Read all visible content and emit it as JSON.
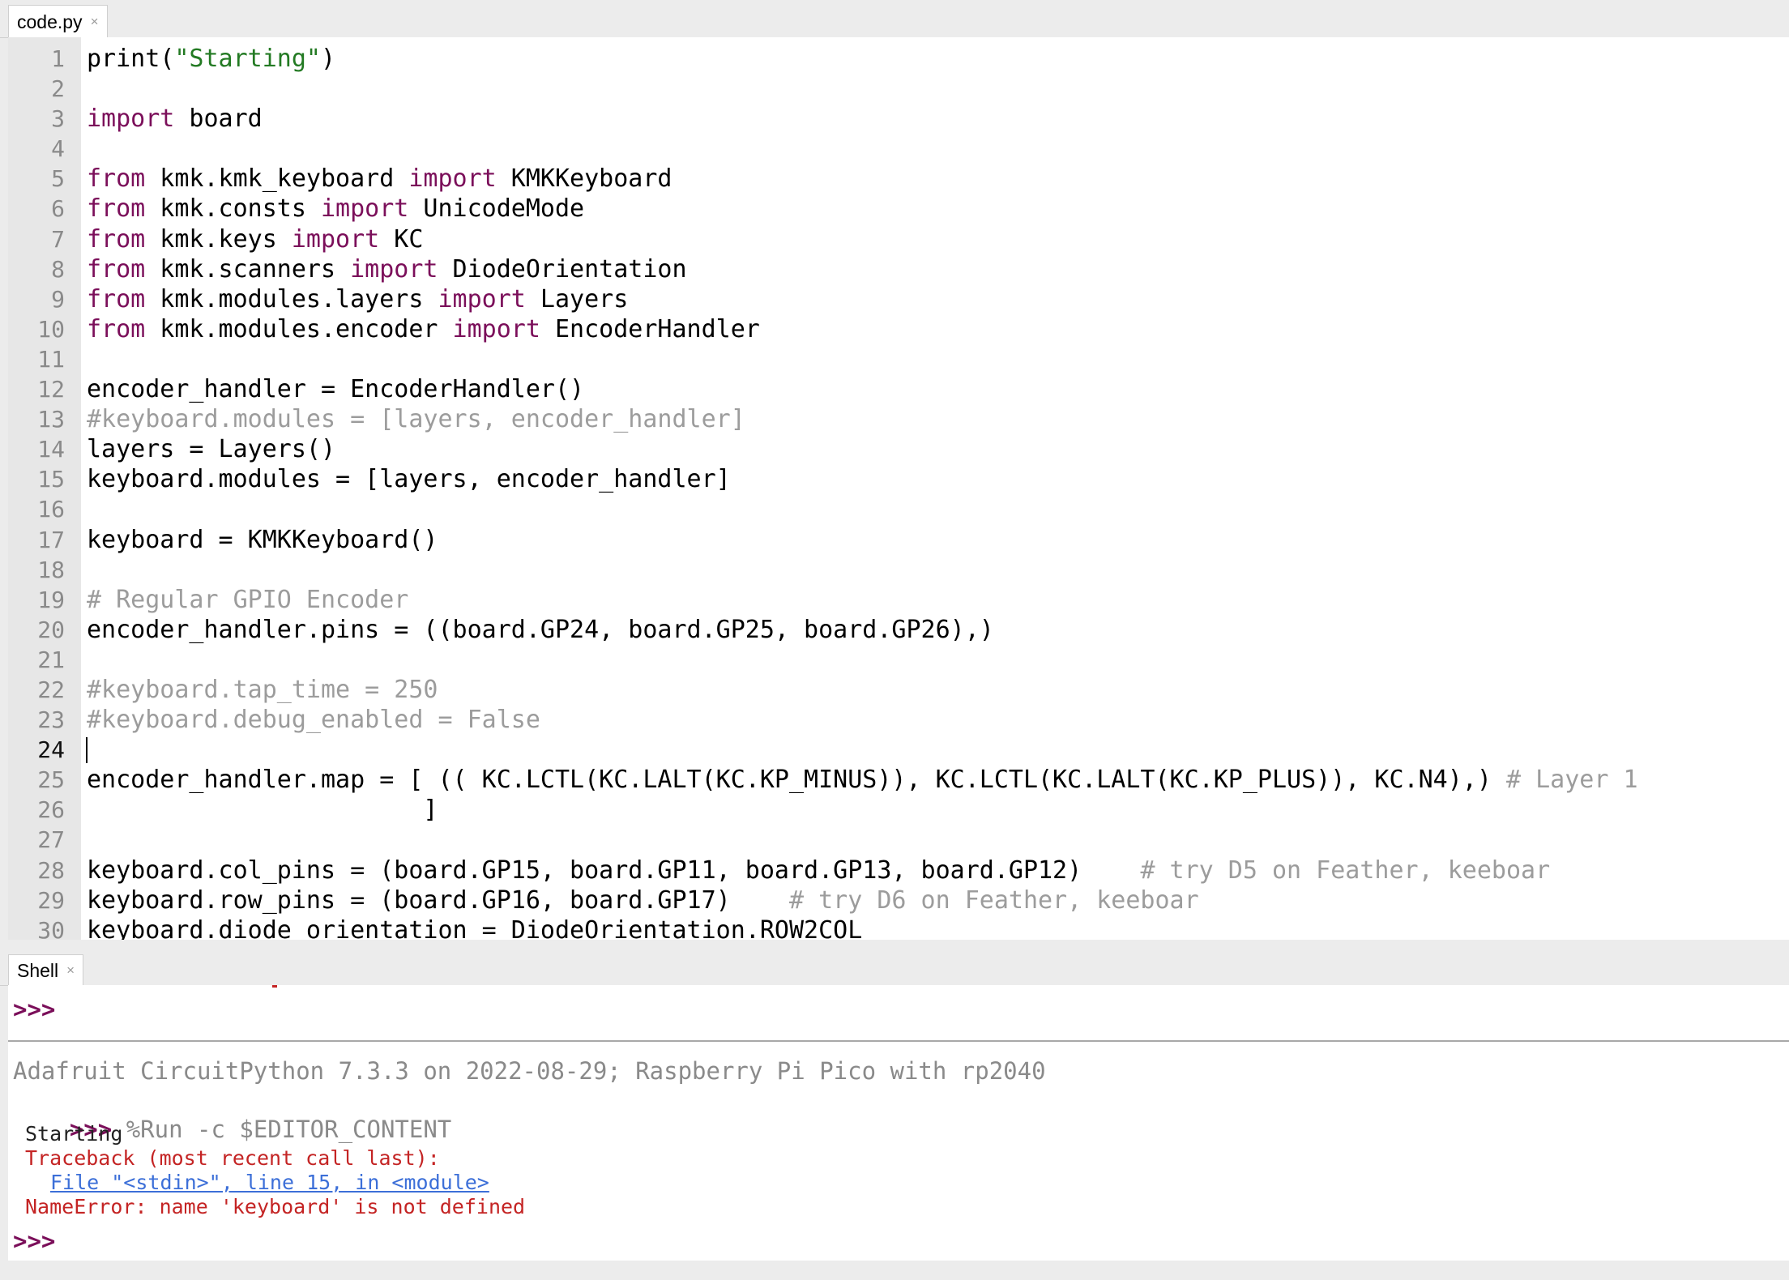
{
  "editor_tab": {
    "label": "code.py",
    "close": "×"
  },
  "shell_tab": {
    "label": "Shell",
    "close": "×"
  },
  "current_line": 24,
  "editor_lines": [
    {
      "n": "1",
      "tokens": [
        [
          "",
          "print("
        ],
        [
          "str",
          "\"Starting\""
        ],
        [
          "",
          ")"
        ]
      ]
    },
    {
      "n": "2",
      "tokens": []
    },
    {
      "n": "3",
      "tokens": [
        [
          "kw",
          "import"
        ],
        [
          "",
          " board"
        ]
      ]
    },
    {
      "n": "4",
      "tokens": []
    },
    {
      "n": "5",
      "tokens": [
        [
          "kw",
          "from"
        ],
        [
          "",
          " kmk.kmk_keyboard "
        ],
        [
          "kw",
          "import"
        ],
        [
          "",
          " KMKKeyboard"
        ]
      ]
    },
    {
      "n": "6",
      "tokens": [
        [
          "kw",
          "from"
        ],
        [
          "",
          " kmk.consts "
        ],
        [
          "kw",
          "import"
        ],
        [
          "",
          " UnicodeMode"
        ]
      ]
    },
    {
      "n": "7",
      "tokens": [
        [
          "kw",
          "from"
        ],
        [
          "",
          " kmk.keys "
        ],
        [
          "kw",
          "import"
        ],
        [
          "",
          " KC"
        ]
      ]
    },
    {
      "n": "8",
      "tokens": [
        [
          "kw",
          "from"
        ],
        [
          "",
          " kmk.scanners "
        ],
        [
          "kw",
          "import"
        ],
        [
          "",
          " DiodeOrientation"
        ]
      ]
    },
    {
      "n": "9",
      "tokens": [
        [
          "kw",
          "from"
        ],
        [
          "",
          " kmk.modules.layers "
        ],
        [
          "kw",
          "import"
        ],
        [
          "",
          " Layers"
        ]
      ]
    },
    {
      "n": "10",
      "tokens": [
        [
          "kw",
          "from"
        ],
        [
          "",
          " kmk.modules.encoder "
        ],
        [
          "kw",
          "import"
        ],
        [
          "",
          " EncoderHandler"
        ]
      ]
    },
    {
      "n": "11",
      "tokens": []
    },
    {
      "n": "12",
      "tokens": [
        [
          "",
          "encoder_handler = EncoderHandler()"
        ]
      ]
    },
    {
      "n": "13",
      "tokens": [
        [
          "cm",
          "#keyboard.modules = [layers, encoder_handler]"
        ]
      ]
    },
    {
      "n": "14",
      "tokens": [
        [
          "",
          "layers = Layers()"
        ]
      ]
    },
    {
      "n": "15",
      "tokens": [
        [
          "",
          "keyboard.modules = [layers, encoder_handler]"
        ]
      ]
    },
    {
      "n": "16",
      "tokens": []
    },
    {
      "n": "17",
      "tokens": [
        [
          "",
          "keyboard = KMKKeyboard()"
        ]
      ]
    },
    {
      "n": "18",
      "tokens": []
    },
    {
      "n": "19",
      "tokens": [
        [
          "cm",
          "# Regular GPIO Encoder"
        ]
      ]
    },
    {
      "n": "20",
      "tokens": [
        [
          "",
          "encoder_handler.pins = ((board.GP24, board.GP25, board.GP26),)"
        ]
      ]
    },
    {
      "n": "21",
      "tokens": []
    },
    {
      "n": "22",
      "tokens": [
        [
          "cm",
          "#keyboard.tap_time = 250"
        ]
      ]
    },
    {
      "n": "23",
      "tokens": [
        [
          "cm",
          "#keyboard.debug_enabled = False"
        ]
      ]
    },
    {
      "n": "24",
      "tokens": []
    },
    {
      "n": "25",
      "tokens": [
        [
          "",
          "encoder_handler.map = [ (( KC.LCTL(KC.LALT(KC.KP_MINUS)), KC.LCTL(KC.LALT(KC.KP_PLUS)), KC.N4),) "
        ],
        [
          "cm",
          "# Layer 1"
        ]
      ]
    },
    {
      "n": "26",
      "tokens": [
        [
          "",
          "                       ]"
        ]
      ]
    },
    {
      "n": "27",
      "tokens": []
    },
    {
      "n": "28",
      "tokens": [
        [
          "",
          "keyboard.col_pins = (board.GP15, board.GP11, board.GP13, board.GP12)    "
        ],
        [
          "cm",
          "# try D5 on Feather, keeboar"
        ]
      ]
    },
    {
      "n": "29",
      "tokens": [
        [
          "",
          "keyboard.row_pins = (board.GP16, board.GP17)    "
        ],
        [
          "cm",
          "# try D6 on Feather, keeboar"
        ]
      ]
    },
    {
      "n": "30",
      "tokens": [
        [
          "",
          "keyboard.diode_orientation = DiodeOrientation.ROW2COL"
        ]
      ]
    }
  ],
  "shell": {
    "prompt_prev": ">>>",
    "banner": "Adafruit CircuitPython 7.3.3 on 2022-08-29; Raspberry Pi Pico with rp2040",
    "run_prompt": ">>>",
    "run_command": " %Run -c $EDITOR_CONTENT",
    "output_starting": "Starting",
    "traceback_header": "Traceback (most recent call last):",
    "traceback_file": "File \"<stdin>\", line 15, in <module>",
    "error_message": "NameError: name 'keyboard' is not defined",
    "final_prompt": ">>>"
  },
  "colors": {
    "keyword": "#7b0f5a",
    "string": "#237a23",
    "comment": "#9c9c9c",
    "error": "#c42424",
    "link": "#3c6fd8"
  }
}
